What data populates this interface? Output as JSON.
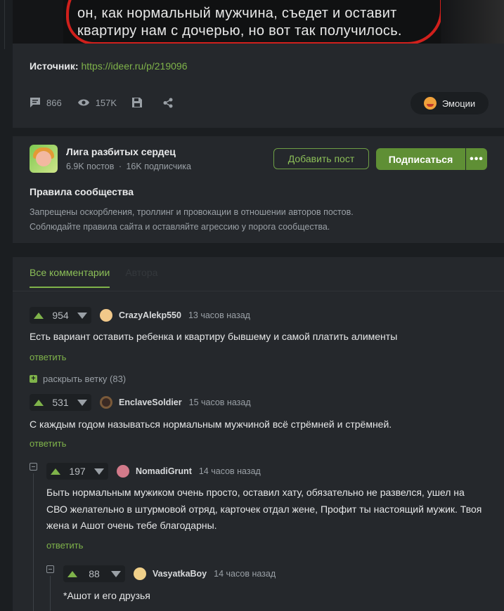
{
  "story": {
    "image_line1": "он, как нормальный мужчина, съедет и оставит",
    "image_line2": "квартиру нам с дочерью, но вот так получилось.",
    "source_label": "Источник:",
    "source_link": "https://ideer.ru/p/219096",
    "comments_count": "866",
    "views_count": "157K",
    "emotions_label": "Эмоции"
  },
  "community": {
    "name": "Лига разбитых сердец",
    "posts": "6.9K постов",
    "subscribers": "16K подписчика",
    "add_post_label": "Добавить пост",
    "subscribe_label": "Подписаться",
    "more_label": "•••",
    "rules_title": "Правила сообщества",
    "rules_line1": "Запрещены оскорбления, троллинг и провокации в отношении авторов постов.",
    "rules_line2": "Соблюдайте правила сайта и оставляйте агрессию у порога сообщества."
  },
  "comments": {
    "tab_all": "Все комментарии",
    "tab_author": "Автора",
    "reply_label": "ответить",
    "expand_label": "раскрыть ветку (83)",
    "items": [
      {
        "rating": "954",
        "user": "CrazyAlekp550",
        "time": "13 часов назад",
        "text": "Есть вариант оставить ребенка и квартиру бывшему и самой платить алименты"
      },
      {
        "rating": "531",
        "user": "EnclaveSoldier",
        "time": "15 часов назад",
        "text": "С каждым годом называться нормальным мужчиной всё стрёмней и стрёмней."
      },
      {
        "rating": "197",
        "user": "NomadiGrunt",
        "time": "14 часов назад",
        "text_line1": "Быть нормальным мужиком очень просто, оставил хату, обязательно не развелся, ушел на",
        "text_line2": "СВО желательно в штурмовой отряд, карточек отдал жене, Профит ты настоящий мужик. Твоя",
        "text_line3": "жена и Ашот очень тебе благодарны."
      },
      {
        "rating": "88",
        "user": "VasyatkaBoy",
        "time": "14 часов назад",
        "text": "*Ашот и его друзья"
      }
    ]
  }
}
